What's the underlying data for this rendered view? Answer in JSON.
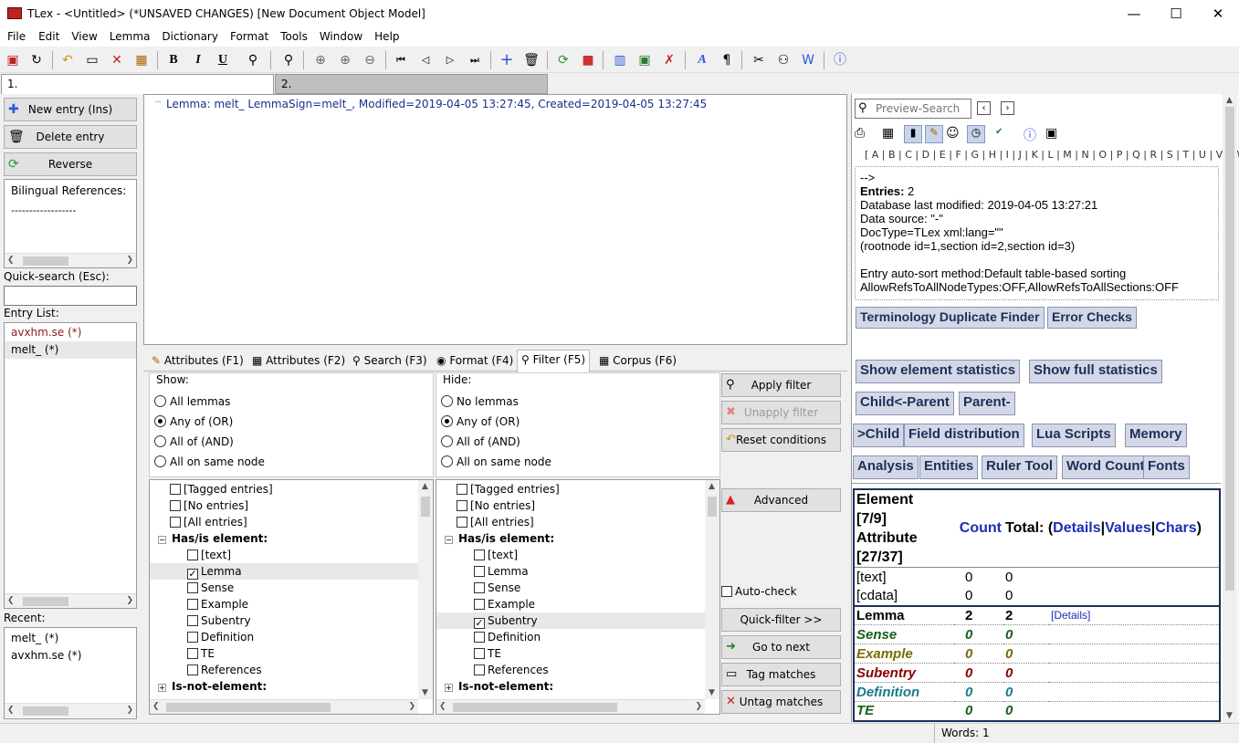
{
  "window": {
    "title": "TLex - <Untitled> (*UNSAVED CHANGES) [New Document Object Model]",
    "minimize": "—",
    "maximize": "☐",
    "close": "✕"
  },
  "menu": [
    "File",
    "Edit",
    "View",
    "Lemma",
    "Dictionary",
    "Format",
    "Tools",
    "Window",
    "Help"
  ],
  "doc_tabs": [
    "1.",
    "2."
  ],
  "left": {
    "new_entry": "New entry (Ins)",
    "delete_entry": "Delete entry",
    "reverse": "Reverse",
    "bilingual_label": "Bilingual References:",
    "bilingual_sep": "------------------",
    "quick_search_label": "Quick-search (Esc):",
    "quick_search_value": "",
    "entry_list_label": "Entry List:",
    "entries": [
      {
        "text": "avxhm.se (*)",
        "color": "#8b1a1a"
      },
      {
        "text": "melt_ (*)",
        "color": "#000"
      }
    ],
    "recent_label": "Recent:",
    "recent": [
      "melt_ (*)",
      "avxhm.se (*)"
    ]
  },
  "editor": {
    "tree_line": "Lemma: melt_  LemmaSign=melt_, Modified=2019-04-05 13:27:45, Created=2019-04-05 13:27:45"
  },
  "bottom_tabs": [
    "Attributes (F1)",
    "Attributes (F2)",
    "Search (F3)",
    "Format (F4)",
    "Filter (F5)",
    "Corpus (F6)"
  ],
  "filter": {
    "show_label": "Show:",
    "hide_label": "Hide:",
    "show_options": [
      "All lemmas",
      "Any of (OR)",
      "All of (AND)",
      "All on same node"
    ],
    "show_selected": 1,
    "hide_options": [
      "No lemmas",
      "Any of (OR)",
      "All of (AND)",
      "All on same node"
    ],
    "hide_selected": 1,
    "tree_top": [
      "[Tagged entries]",
      "[No entries]",
      "[All entries]"
    ],
    "has_element": "Has/is element:",
    "elements": [
      "[text]",
      "Lemma",
      "Sense",
      "Example",
      "Subentry",
      "Definition",
      "TE",
      "References"
    ],
    "show_checked": "Lemma",
    "hide_checked": "Subentry",
    "not_element": "Is-not-element:",
    "buttons": {
      "apply": "Apply filter",
      "unapply": "Unapply filter",
      "reset": "Reset conditions",
      "advanced": "Advanced",
      "autocheck": "Auto-check",
      "quickfilter": "Quick-filter >>",
      "goto": "Go to next",
      "tag": "Tag matches",
      "untag": "Untag matches"
    }
  },
  "preview": {
    "search_placeholder": "Preview-Search",
    "alphabet": "[ A | B | C | D | E | F | G | H | I | J | K | L | M | N | O | P | Q | R | S | T | U | V | W | X | Y | Z ]",
    "info_arrow": "-->",
    "entries_label": "Entries:",
    "entries_value": " 2",
    "lines": [
      "Database last modified: 2019-04-05 13:27:21",
      "Data source: \"-\"",
      "DocType=TLex xml:lang=\"\"",
      "(rootnode id=1,section id=2,section id=3)",
      "",
      "Entry auto-sort method:Default table-based sorting",
      "AllowRefsToAllNodeTypes:OFF,AllowRefsToAllSections:OFF"
    ],
    "buttons": [
      "Terminology Duplicate Finder",
      "Error Checks",
      "Show element statistics",
      "Show full statistics",
      "Child<-Parent",
      "Parent-",
      ">Child",
      "Field distribution",
      "Lua Scripts",
      "Memory",
      "Analysis",
      "Entities",
      "Ruler Tool",
      "Word Count",
      "Fonts"
    ],
    "stats_header": {
      "element": "Element",
      "element_count": "[7/9]",
      "attribute": "Attribute",
      "attribute_count": "[27/37]",
      "count": "Count",
      "total": "Total:",
      "paren_open": "(",
      "details": "Details",
      "sep": "|",
      "values": "Values",
      "chars": "Chars",
      "paren_close": ")"
    },
    "stats_rows": [
      {
        "name": "[text]",
        "count": "0",
        "total": "0",
        "extra": "",
        "color": "#000",
        "style": "normal"
      },
      {
        "name": "[cdata]",
        "count": "0",
        "total": "0",
        "extra": "",
        "color": "#000",
        "style": "normal"
      },
      {
        "name": "Lemma",
        "count": "2",
        "total": "2",
        "extra": "[Details]",
        "color": "#000",
        "style": "bold"
      },
      {
        "name": "Sense",
        "count": "0",
        "total": "0",
        "extra": "",
        "color": "#1a5e1a",
        "style": "bolditalic"
      },
      {
        "name": "Example",
        "count": "0",
        "total": "0",
        "extra": "",
        "color": "#7a6a00",
        "style": "bolditalic"
      },
      {
        "name": "Subentry",
        "count": "0",
        "total": "0",
        "extra": "",
        "color": "#8b0000",
        "style": "bolditalic"
      },
      {
        "name": "Definition",
        "count": "0",
        "total": "0",
        "extra": "",
        "color": "#1a7a8a",
        "style": "bolditalic"
      },
      {
        "name": "TE",
        "count": "0",
        "total": "0",
        "extra": "",
        "color": "#1a5e1a",
        "style": "bolditalic"
      }
    ]
  },
  "status": {
    "words": "Words: 1"
  },
  "colors": {
    "editor_text": "#1a2f8a",
    "link": "#1a2fb5"
  }
}
